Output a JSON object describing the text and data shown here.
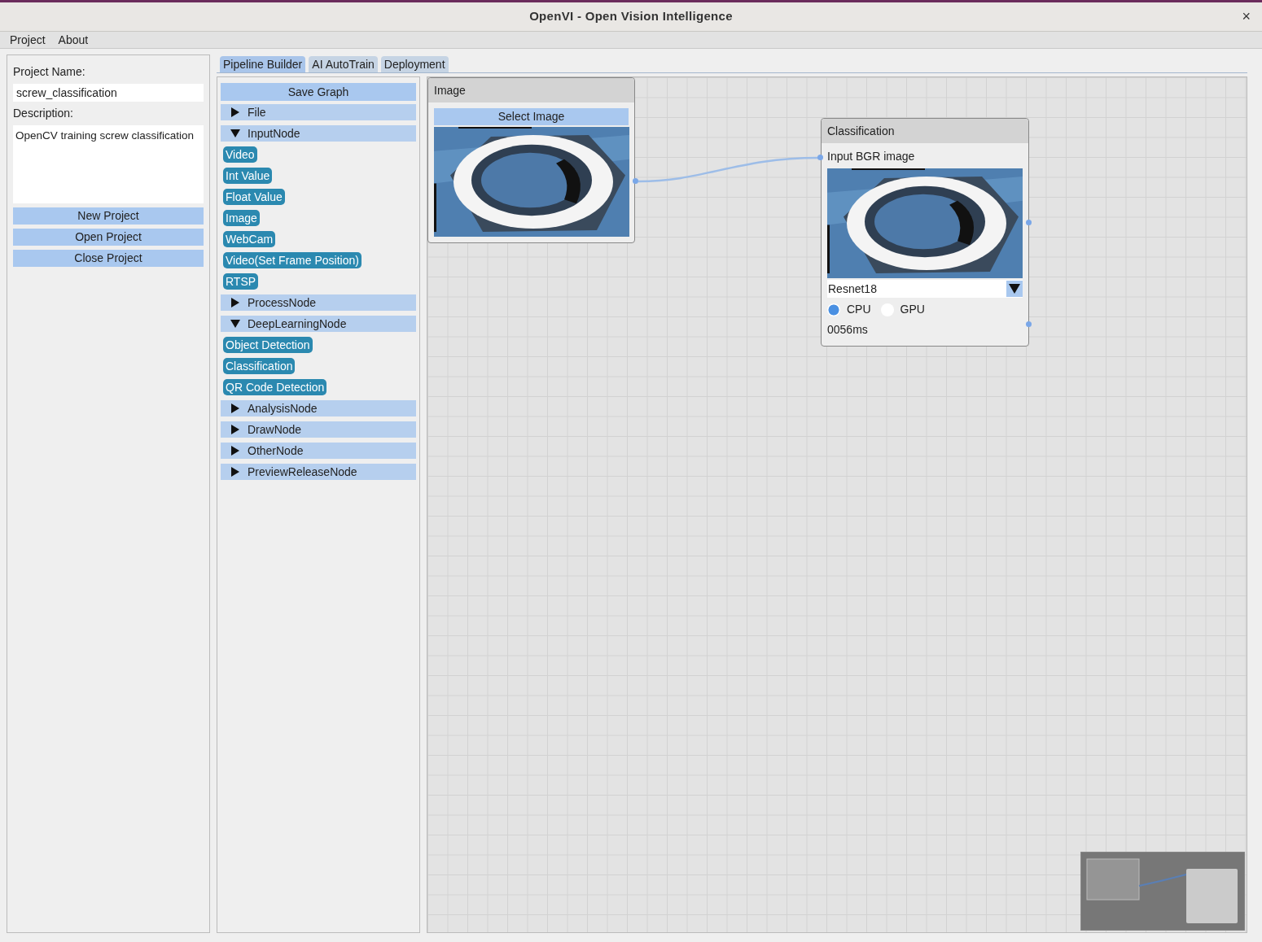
{
  "window": {
    "title": "OpenVI - Open Vision Intelligence",
    "close": "×"
  },
  "menu": [
    {
      "label": "Project"
    },
    {
      "label": "About"
    }
  ],
  "project_panel": {
    "name_label": "Project Name:",
    "name_value": "screw_classification",
    "description_label": "Description:",
    "description_value": "OpenCV training screw classification",
    "buttons": [
      "New Project",
      "Open Project",
      "Close Project"
    ]
  },
  "tabs": [
    {
      "label": "Pipeline Builder",
      "selected": true
    },
    {
      "label": "AI AutoTrain",
      "selected": false
    },
    {
      "label": "Deployment",
      "selected": false
    }
  ],
  "node_palette": {
    "save_button": "Save Graph",
    "groups": [
      {
        "label": "File",
        "expanded": false
      },
      {
        "label": "InputNode",
        "expanded": true,
        "items": [
          "Video",
          "Int Value",
          "Float Value",
          "Image",
          "WebCam",
          "Video(Set Frame Position)",
          "RTSP"
        ]
      },
      {
        "label": "ProcessNode",
        "expanded": false
      },
      {
        "label": "DeepLearningNode",
        "expanded": true,
        "items": [
          "Object Detection",
          "Classification",
          "QR Code Detection"
        ]
      },
      {
        "label": "AnalysisNode",
        "expanded": false
      },
      {
        "label": "DrawNode",
        "expanded": false
      },
      {
        "label": "OtherNode",
        "expanded": false
      },
      {
        "label": "PreviewReleaseNode",
        "expanded": false
      }
    ]
  },
  "canvas": {
    "nodes": [
      {
        "title": "Image",
        "button": "Select Image",
        "picture": {
          "kind": "picture"
        }
      },
      {
        "kind": "classification",
        "title": "Classification",
        "input_label": "Input BGR image",
        "picture": {
          "kind": "picture"
        },
        "model": "Resnet18",
        "devices": [
          {
            "label": "CPU",
            "selected": true
          },
          {
            "label": "GPU",
            "selected": false
          }
        ],
        "time": "0056ms"
      }
    ]
  }
}
